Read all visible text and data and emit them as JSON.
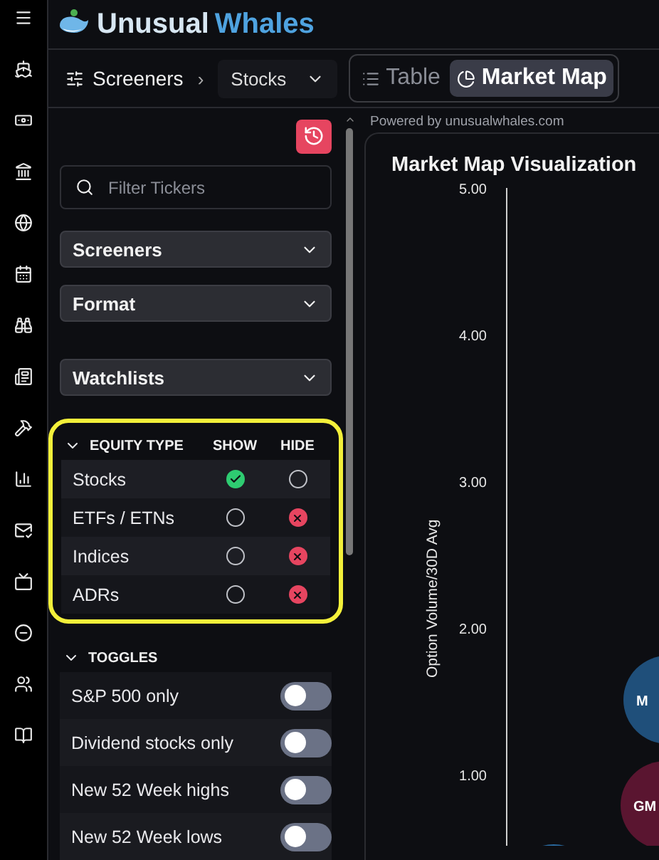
{
  "logo": {
    "first": "Unusual",
    "second": "Whales"
  },
  "toolbar": {
    "breadcrumb": "Screeners",
    "separator": "›",
    "dropdown": "Stocks",
    "views": [
      {
        "label": "Table",
        "kind": "list",
        "selected": false
      },
      {
        "label": "Market Map",
        "kind": "pie",
        "selected": true
      }
    ]
  },
  "sidebar": {
    "filter": {
      "placeholder": "Filter Tickers"
    },
    "dropdowns": [
      "Screeners",
      "Format",
      "Watchlists"
    ],
    "equity_type": {
      "title": "EQUITY TYPE",
      "columns": [
        "SHOW",
        "HIDE"
      ],
      "expanded": true,
      "highlighted": true,
      "rows": [
        {
          "label": "Stocks",
          "show": true,
          "hide": false
        },
        {
          "label": "ETFs / ETNs",
          "show": false,
          "hide": true
        },
        {
          "label": "Indices",
          "show": false,
          "hide": true
        },
        {
          "label": "ADRs",
          "show": false,
          "hide": true
        }
      ]
    },
    "toggles": {
      "title": "TOGGLES",
      "expanded": true,
      "items": [
        {
          "label": "S&P 500 only",
          "on": false
        },
        {
          "label": "Dividend stocks only",
          "on": false
        },
        {
          "label": "New 52 Week highs",
          "on": false
        },
        {
          "label": "New 52 Week lows",
          "on": false
        }
      ]
    }
  },
  "powered_by": "Powered by unusualwhales.com",
  "chart": {
    "title": "Market Map Visualization",
    "y_axis_title": "Option Volume/30D Avg",
    "y_tick_labels": [
      "5.00",
      "4.00",
      "3.00",
      "2.00",
      "1.00"
    ],
    "bubbles": [
      {
        "label": "M",
        "color": "#1f4f7a"
      },
      {
        "label": "GM",
        "color": "#5a1530"
      }
    ]
  }
}
